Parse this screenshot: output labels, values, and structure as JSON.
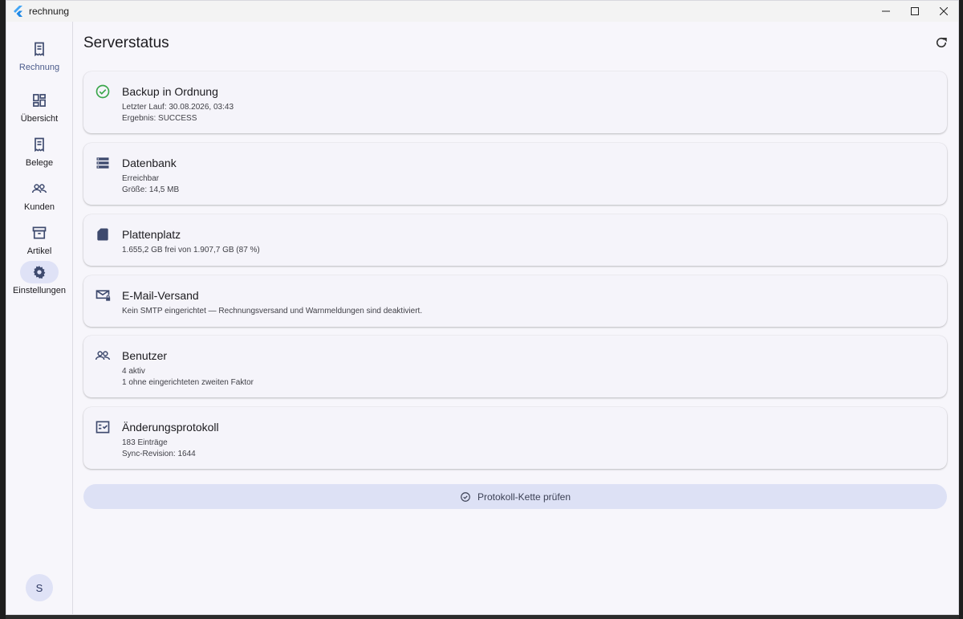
{
  "window": {
    "title": "rechnung"
  },
  "sidebar": {
    "items": [
      {
        "label": "Rechnung",
        "icon": "receipt-icon",
        "active": false,
        "brand": true
      },
      {
        "label": "Übersicht",
        "icon": "dashboard-icon",
        "active": false
      },
      {
        "label": "Belege",
        "icon": "document-icon",
        "active": false
      },
      {
        "label": "Kunden",
        "icon": "people-icon",
        "active": false
      },
      {
        "label": "Artikel",
        "icon": "archive-icon",
        "active": false
      },
      {
        "label": "Einstellungen",
        "icon": "gear-icon",
        "active": true
      }
    ],
    "avatar": "S"
  },
  "main": {
    "title": "Serverstatus",
    "cards": [
      {
        "title": "Backup in Ordnung",
        "icon": "check-circle-icon",
        "lines": [
          "Letzter Lauf: 30.08.2026, 03:43",
          "Ergebnis: SUCCESS"
        ]
      },
      {
        "title": "Datenbank",
        "icon": "storage-icon",
        "lines": [
          "Erreichbar",
          "Größe: 14,5 MB"
        ]
      },
      {
        "title": "Plattenplatz",
        "icon": "sd-card-icon",
        "lines": [
          "1.655,2 GB frei von 1.907,7 GB (87 %)"
        ]
      },
      {
        "title": "E-Mail-Versand",
        "icon": "mail-lock-icon",
        "lines": [
          "Kein SMTP eingerichtet — Rechnungsversand und Warnmeldungen sind deaktiviert."
        ]
      },
      {
        "title": "Benutzer",
        "icon": "people-icon",
        "lines": [
          "4 aktiv",
          "1 ohne eingerichteten zweiten Faktor"
        ]
      },
      {
        "title": "Änderungsprotokoll",
        "icon": "checklist-icon",
        "lines": [
          "183 Einträge",
          "Sync-Revision: 1644"
        ]
      }
    ],
    "action_button": "Protokoll-Kette prüfen"
  },
  "colors": {
    "accent": "#4a5a8a",
    "success": "#3aa64b",
    "icon": "#3e4a6e",
    "pill": "#dfe2f6"
  }
}
